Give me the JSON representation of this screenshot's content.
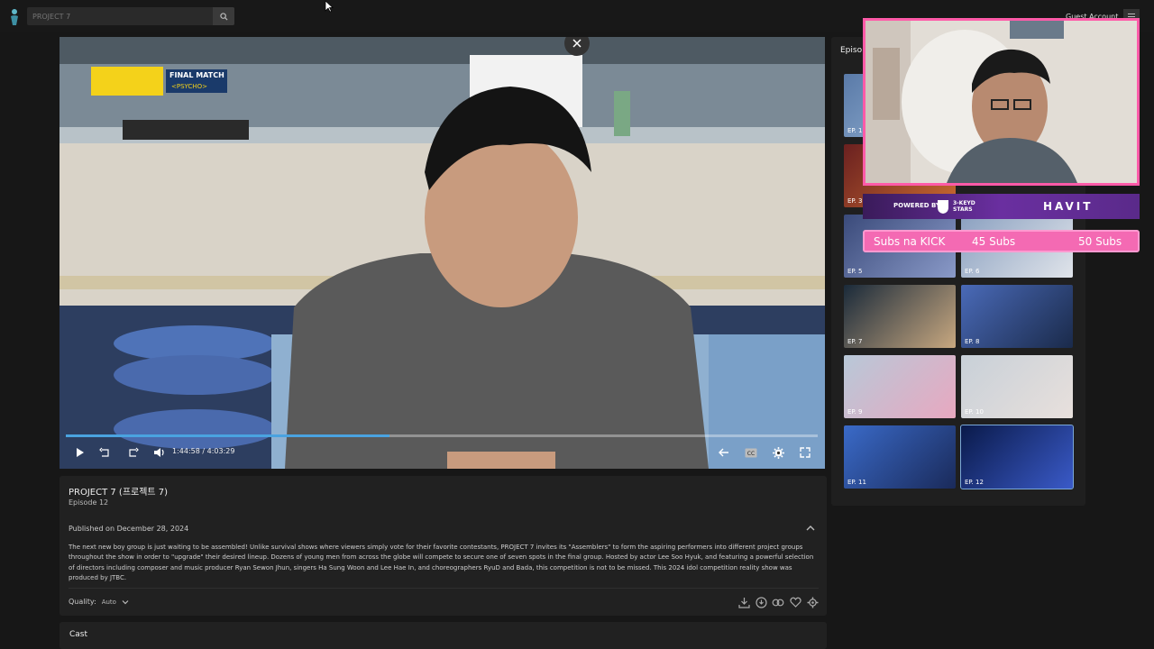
{
  "search": {
    "placeholder": "PROJECT 7"
  },
  "account": {
    "label": "Guest Account"
  },
  "player": {
    "overlay_badge": "FINAL MATCH",
    "overlay_sub": "<PSYCHO>",
    "current_time": "1:44:58",
    "time_sep": "/",
    "duration": "4:03:29",
    "progress_fraction": 0.43
  },
  "show": {
    "title": "PROJECT 7 (프로젝트 7)",
    "episode": "Episode 12",
    "published": "Published on December 28, 2024",
    "description": "The next new boy group is just waiting to be assembled! Unlike survival shows where viewers simply vote for their favorite contestants, PROJECT 7 invites its \"Assemblers\" to form the aspiring performers into different project groups throughout the show in order to \"upgrade\" their desired lineup. Dozens of young men from across the globe will compete to secure one of seven spots in the final group. Hosted by actor Lee Soo Hyuk, and featuring a powerful selection of directors including composer and music producer Ryan Sewon Jhun, singers Ha Sung Woon and Lee Hae In, and choreographers RyuD and Bada, this competition is not to be missed. This 2024 idol competition reality show was produced by JTBC.",
    "quality_label": "Quality:",
    "quality_value": "Auto"
  },
  "cast": {
    "label": "Cast"
  },
  "episodes_panel": {
    "title": "Episo",
    "items": [
      {
        "label": "EP. 1"
      },
      {
        "label": "EP. 3"
      },
      {
        "label": "EP. 5"
      },
      {
        "label": "EP. 6"
      },
      {
        "label": "EP. 7"
      },
      {
        "label": "EP. 8"
      },
      {
        "label": "EP. 9"
      },
      {
        "label": "EP. 10"
      },
      {
        "label": "EP. 11"
      },
      {
        "label": "EP. 12"
      }
    ]
  },
  "stream": {
    "powered_by": "POWERED BY",
    "sponsor1_line1": "3-KEYD",
    "sponsor1_line2": "STARS",
    "sponsor2": "HAVIT",
    "subs_label": "Subs na KICK",
    "subs_current": "45 Subs",
    "subs_goal": "50 Subs"
  },
  "colors": {
    "accent": "#4aa3e0",
    "stream_border": "#ff5aa8",
    "subs_bar": "#f46ab3"
  }
}
